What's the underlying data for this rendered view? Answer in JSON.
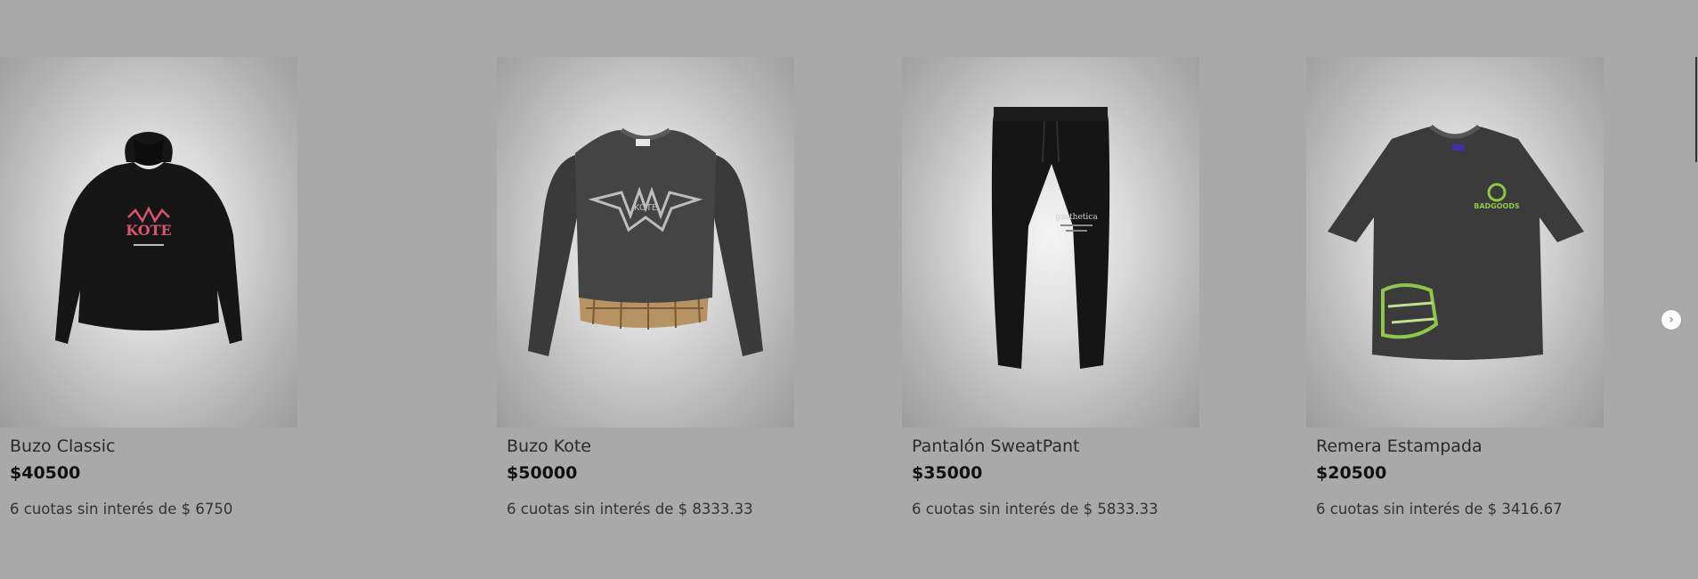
{
  "carousel": {
    "prev_icon": "chevron-left-icon",
    "next_icon": "chevron-right-icon",
    "prev_glyph": "‹",
    "next_glyph": "›",
    "products": [
      {
        "title": "Buzo Kote",
        "price": "$50000",
        "installments": "6 cuotas sin interés de $ 8333.33",
        "image": "sweatshirt-image",
        "print_text": "KOTE"
      },
      {
        "title": "Pantalón SweatPant",
        "price": "$35000",
        "installments": "6 cuotas sin interés de $ 5833.33",
        "image": "sweatpants-image",
        "print_text": "gasthetica"
      },
      {
        "title": "Remera Estampada",
        "price": "$20500",
        "installments": "6 cuotas sin interés de $ 3416.67",
        "image": "tshirt-image",
        "print_text": "BADGOODS"
      },
      {
        "title": "Buzo Classic",
        "price": "$40500",
        "installments": "6 cuotas sin interés de $ 6750",
        "image": "hoodie-image",
        "print_text": "KOTE"
      }
    ]
  },
  "colors": {
    "background": "#a9a9a9",
    "garment_dark": "#2b2b2b",
    "garment_black": "#151515",
    "print_grey": "#bdbdbd",
    "print_green": "#8fc64a",
    "print_pink": "#d9546e",
    "flannel": "#b59363"
  }
}
